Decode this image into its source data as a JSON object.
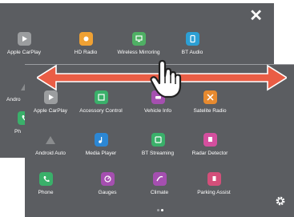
{
  "colors": {
    "panel": "#5b5d61",
    "text": "#ffffff",
    "arrow": "#ea5d45",
    "dot_active": "#ffffff",
    "dot_inactive": "#9fa1a5"
  },
  "back_screen": {
    "close_icon": "close-icon",
    "apps": [
      {
        "label": "Apple CarPlay",
        "icon": "carplay-icon",
        "color": "#9b9d9f"
      },
      {
        "label": "HD Radio",
        "icon": "hd-radio-icon",
        "color": "#f0a133"
      },
      {
        "label": "Wireless Mirroring",
        "icon": "wireless-mirroring-icon",
        "color": "#4fb064"
      },
      {
        "label": "BT Audio",
        "icon": "bt-audio-icon",
        "color": "#2c9fd4"
      },
      {
        "label": "Andro",
        "icon": "android-auto-icon",
        "color": "#8a8c8e"
      },
      {
        "label": "Ph",
        "icon": "phone-icon",
        "color": "#3ab06a"
      }
    ]
  },
  "front_screen": {
    "apps": [
      {
        "label": "Apple CarPlay",
        "icon": "carplay-icon",
        "color": "#9b9d9f"
      },
      {
        "label": "Accessory Control",
        "icon": "accessory-control-icon",
        "color": "#3ab06a"
      },
      {
        "label": "Vehicle Info",
        "icon": "vehicle-info-icon",
        "color": "#a54fb0"
      },
      {
        "label": "Satelite Radio",
        "icon": "satellite-radio-icon",
        "color": "#e78a2f"
      },
      {
        "label": "Android Auto",
        "icon": "android-auto-icon",
        "color": "#8a8c8e"
      },
      {
        "label": "Media Player",
        "icon": "media-player-icon",
        "color": "#2c87d4"
      },
      {
        "label": "BT Streaming",
        "icon": "bt-streaming-icon",
        "color": "#3ab06a"
      },
      {
        "label": "Radar Detector",
        "icon": "radar-detector-icon",
        "color": "#d44f9e"
      },
      {
        "label": "Phone",
        "icon": "phone-icon",
        "color": "#3ab06a"
      },
      {
        "label": "Gauges",
        "icon": "gauges-icon",
        "color": "#a54fb0"
      },
      {
        "label": "Climate",
        "icon": "climate-icon",
        "color": "#a54fb0"
      },
      {
        "label": "Parking Assist",
        "icon": "parking-assist-icon",
        "color": "#d44f7a"
      }
    ],
    "page_indicator": {
      "pages": 2,
      "current": 2
    },
    "settings_icon": "gear-icon"
  },
  "gesture": {
    "arrow_icon": "swipe-arrow-icon",
    "hand_icon": "hand-pointer-icon"
  }
}
